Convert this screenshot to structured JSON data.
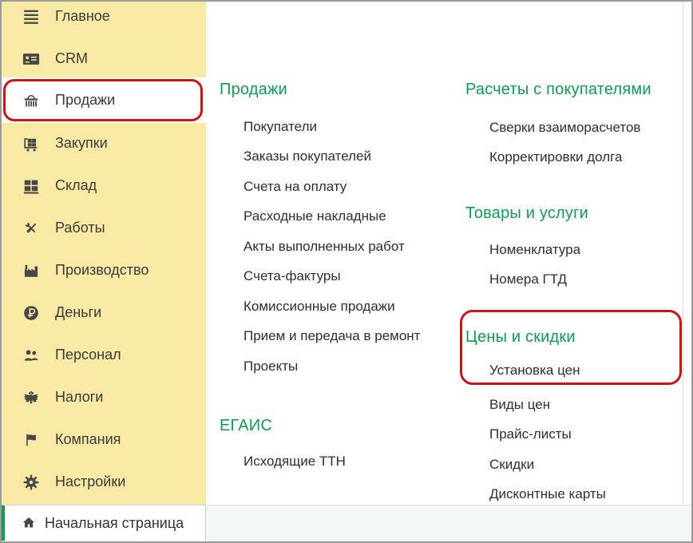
{
  "colors": {
    "sidebar_bg": "#f8e9a4",
    "accent_green": "#0aa14e",
    "annotation_red": "#cf1313",
    "text_primary": "#2e2e2e",
    "icon_gray": "#474747",
    "frame_border": "#9a9a9a",
    "footer_strip": "#f2f7f6"
  },
  "sidebar": {
    "items": [
      {
        "label": "Главное",
        "icon": "menu-icon",
        "selected": false
      },
      {
        "label": "CRM",
        "icon": "crm-card-icon",
        "selected": false
      },
      {
        "label": "Продажи",
        "icon": "basket-icon",
        "selected": true
      },
      {
        "label": "Закупки",
        "icon": "cart-icon",
        "selected": false
      },
      {
        "label": "Склад",
        "icon": "warehouse-icon",
        "selected": false
      },
      {
        "label": "Работы",
        "icon": "tools-icon",
        "selected": false
      },
      {
        "label": "Производство",
        "icon": "factory-icon",
        "selected": false
      },
      {
        "label": "Деньги",
        "icon": "ruble-icon",
        "selected": false
      },
      {
        "label": "Персонал",
        "icon": "people-icon",
        "selected": false
      },
      {
        "label": "Налоги",
        "icon": "eagle-icon",
        "selected": false
      },
      {
        "label": "Компания",
        "icon": "flag-icon",
        "selected": false
      },
      {
        "label": "Настройки",
        "icon": "gear-icon",
        "selected": false
      }
    ]
  },
  "footer": {
    "label": "Начальная страница",
    "icon": "home-icon"
  },
  "menu": {
    "column1": {
      "sections": [
        {
          "title": "Продажи",
          "items": [
            "Покупатели",
            "Заказы покупателей",
            "Счета на оплату",
            "Расходные накладные",
            "Акты выполненных работ",
            "Счета-фактуры",
            "Комиссионные продажи",
            "Прием и передача в ремонт",
            "Проекты"
          ]
        },
        {
          "title": "ЕГАИС",
          "items": [
            "Исходящие ТТН"
          ]
        }
      ]
    },
    "column2": {
      "sections": [
        {
          "title": "Расчеты с покупателями",
          "items": [
            "Сверки взаиморасчетов",
            "Корректировки долга"
          ]
        },
        {
          "title": "Товары и услуги",
          "items": [
            "Номенклатура",
            "Номера ГТД"
          ]
        },
        {
          "title": "Цены и скидки",
          "items": [
            "Установка цен",
            "Виды цен",
            "Прайс-листы",
            "Скидки",
            "Дисконтные карты"
          ]
        }
      ]
    }
  }
}
